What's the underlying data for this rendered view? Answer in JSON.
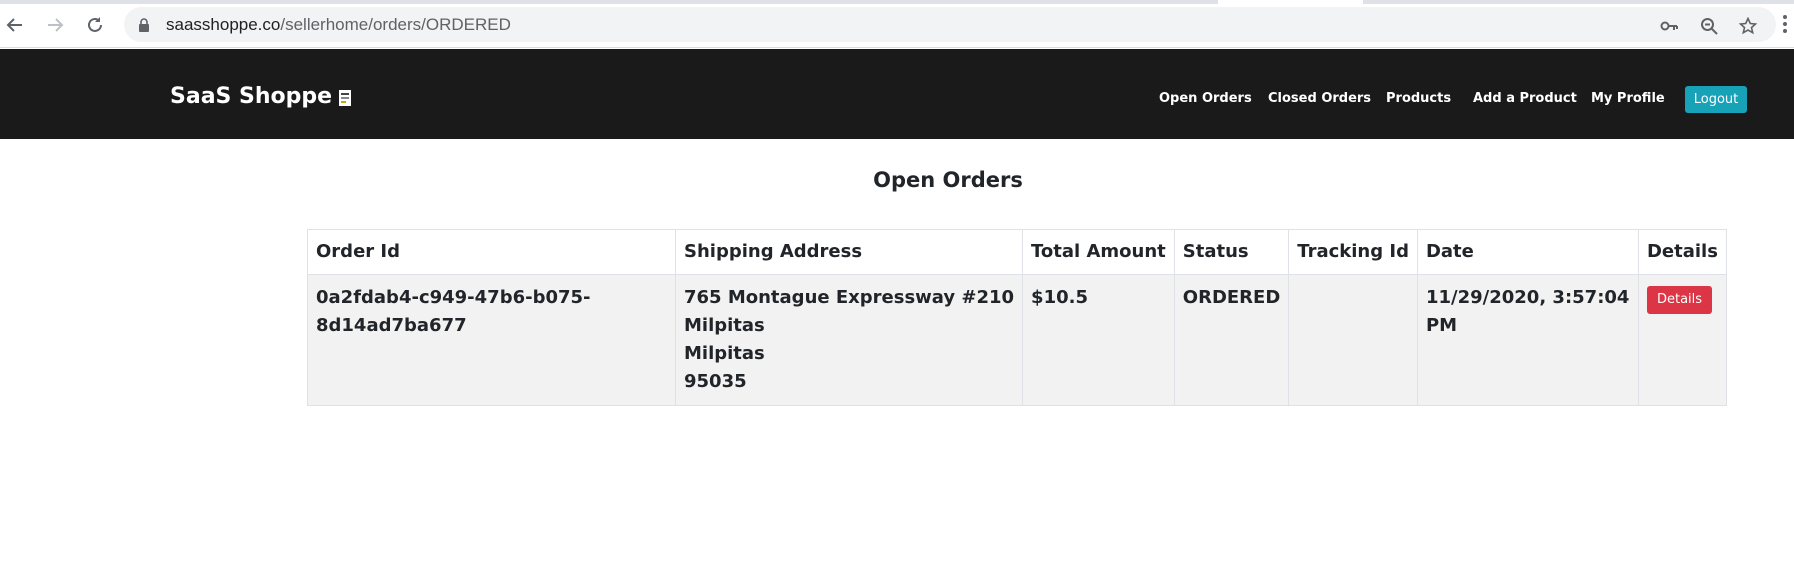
{
  "browser": {
    "url_host": "saasshoppe.co",
    "url_path": "/sellerhome/orders/ORDERED"
  },
  "navbar": {
    "brand": "SaaS Shoppe",
    "links": [
      "Open Orders",
      "Closed Orders",
      "Products",
      "Add a Product",
      "My Profile"
    ],
    "logout_label": "Logout",
    "logout_color": "#17a2b8"
  },
  "main": {
    "title": "Open Orders",
    "table": {
      "headers": [
        "Order Id",
        "Shipping Address",
        "Total Amount",
        "Status",
        "Tracking Id",
        "Date",
        "Details"
      ],
      "rows": [
        {
          "order_id": "0a2fdab4-c949-47b6-b075-8d14ad7ba677",
          "address": [
            "765 Montague Expressway #210",
            "Milpitas",
            "Milpitas",
            "95035"
          ],
          "total": "$10.5",
          "status": "ORDERED",
          "tracking_id": "",
          "date": "11/29/2020, 3:57:04 PM",
          "details_label": "Details"
        }
      ]
    },
    "details_button_color": "#dc3545"
  }
}
